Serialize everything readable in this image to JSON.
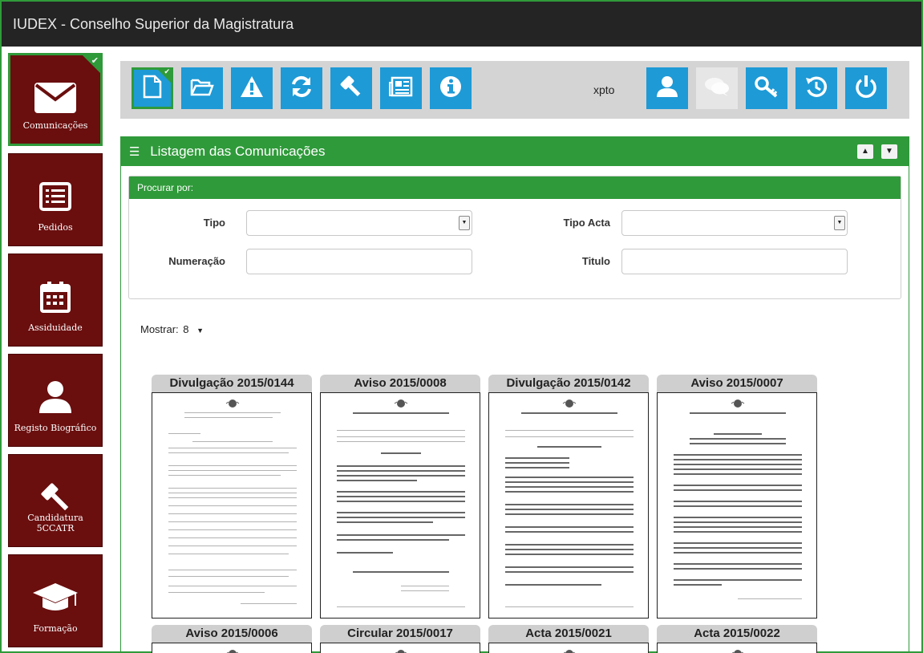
{
  "app": {
    "title": "IUDEX - Conselho Superior da Magistratura"
  },
  "sidebar": {
    "items": [
      {
        "label": "Comunicações",
        "icon": "envelope-icon",
        "active": true
      },
      {
        "label": "Pedidos",
        "icon": "list-icon",
        "active": false
      },
      {
        "label": "Assiduidade",
        "icon": "calendar-icon",
        "active": false
      },
      {
        "label": "Registo Biográfico",
        "icon": "user-icon",
        "active": false
      },
      {
        "label": "Candidatura 5CCATR",
        "icon": "gavel-icon",
        "active": false
      },
      {
        "label": "Formação",
        "icon": "graduation-cap-icon",
        "active": false
      }
    ]
  },
  "toolbar": {
    "left_buttons": [
      "new-document-icon",
      "folder-open-icon",
      "warning-icon",
      "refresh-icon",
      "gavel-icon",
      "newspaper-icon",
      "info-icon"
    ],
    "username": "xpto",
    "right_buttons": [
      "user-icon",
      "chat-icon",
      "key-icon",
      "history-icon",
      "power-icon"
    ]
  },
  "panel": {
    "title": "Listagem das Comunicações"
  },
  "search": {
    "header": "Procurar por:",
    "tipo_label": "Tipo",
    "tipo_value": "",
    "tipo_acta_label": "Tipo Acta",
    "tipo_acta_value": "",
    "numeracao_label": "Numeração",
    "numeracao_value": "",
    "titulo_label": "Titulo",
    "titulo_value": ""
  },
  "paging": {
    "show_label": "Mostrar:",
    "show_value": "8"
  },
  "documents": [
    {
      "title": "Divulgação 2015/0144"
    },
    {
      "title": "Aviso 2015/0008"
    },
    {
      "title": "Divulgação 2015/0142"
    },
    {
      "title": "Aviso 2015/0007"
    },
    {
      "title": "Aviso 2015/0006"
    },
    {
      "title": "Circular 2015/0017"
    },
    {
      "title": "Acta 2015/0021"
    },
    {
      "title": "Acta 2015/0022"
    }
  ],
  "colors": {
    "sidebar_bg": "#6a0e0e",
    "accent_green": "#2f9a3a",
    "toolbar_blue": "#1e9ad6",
    "titlebar_bg": "#242424"
  }
}
